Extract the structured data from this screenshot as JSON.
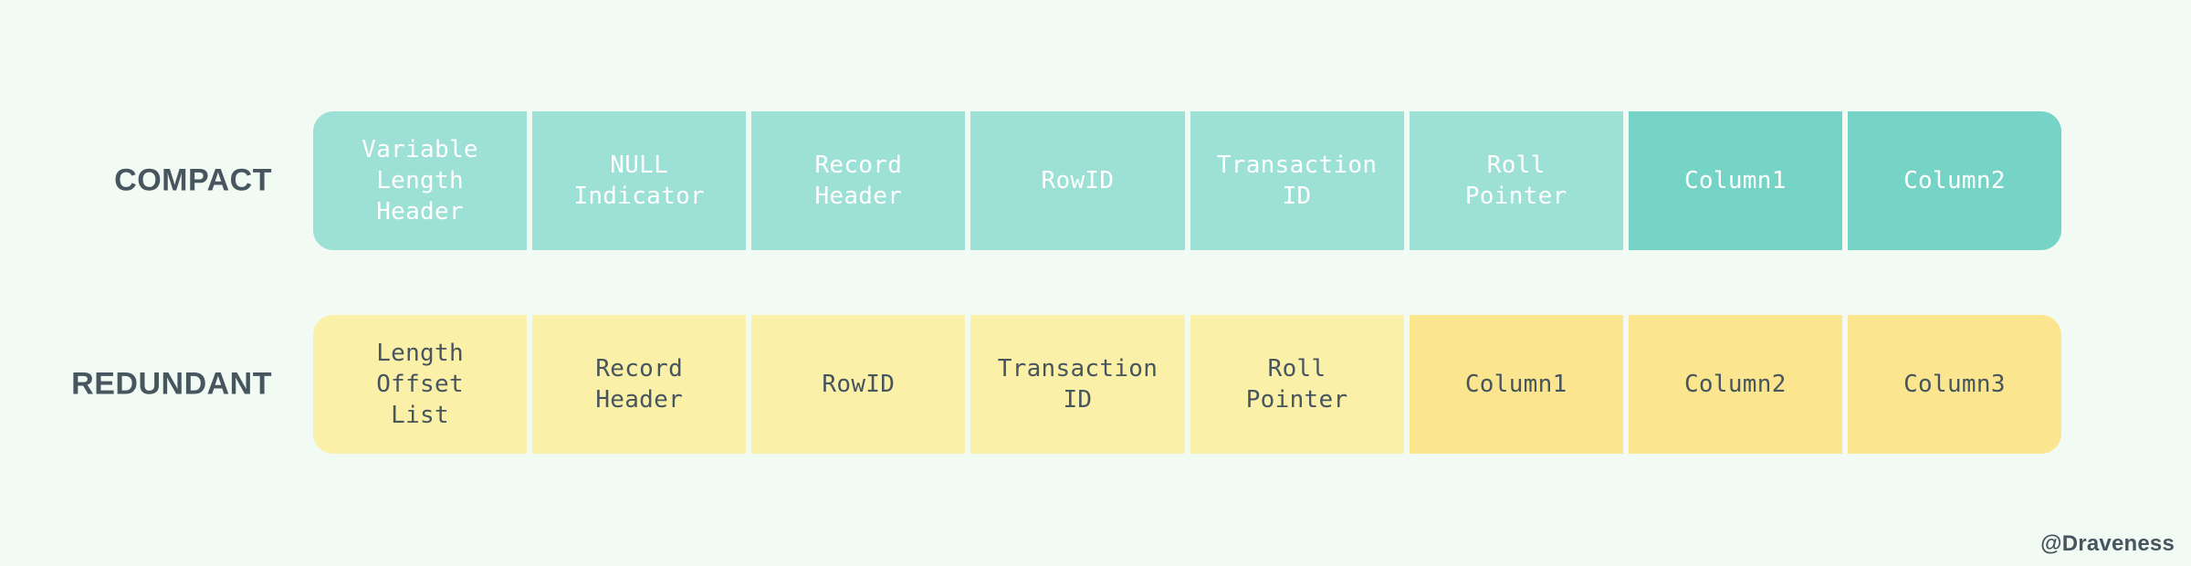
{
  "background_color": "#f2fbf3",
  "label_color": "#46555e",
  "rows": [
    {
      "label": "COMPACT",
      "base_color": "#9ce0d6",
      "accent_color": "#76d4c7",
      "text_color": "#ffffff",
      "cells": [
        {
          "text": "Variable\nLength\nHeader",
          "emphasis": false
        },
        {
          "text": "NULL\nIndicator",
          "emphasis": false
        },
        {
          "text": "Record\nHeader",
          "emphasis": false
        },
        {
          "text": "RowID",
          "emphasis": false
        },
        {
          "text": "Transaction\nID",
          "emphasis": false
        },
        {
          "text": "Roll\nPointer",
          "emphasis": false
        },
        {
          "text": "Column1",
          "emphasis": true
        },
        {
          "text": "Column2",
          "emphasis": true
        }
      ]
    },
    {
      "label": "REDUNDANT",
      "base_color": "#faf0a8",
      "accent_color": "#fbe58f",
      "text_color": "#46555e",
      "cells": [
        {
          "text": "Length\nOffset\nList",
          "emphasis": false
        },
        {
          "text": "Record\nHeader",
          "emphasis": false
        },
        {
          "text": "RowID",
          "emphasis": false
        },
        {
          "text": "Transaction\nID",
          "emphasis": false
        },
        {
          "text": "Roll\nPointer",
          "emphasis": false
        },
        {
          "text": "Column1",
          "emphasis": true
        },
        {
          "text": "Column2",
          "emphasis": true
        },
        {
          "text": "Column3",
          "emphasis": true
        }
      ]
    }
  ],
  "watermark": "@Draveness"
}
